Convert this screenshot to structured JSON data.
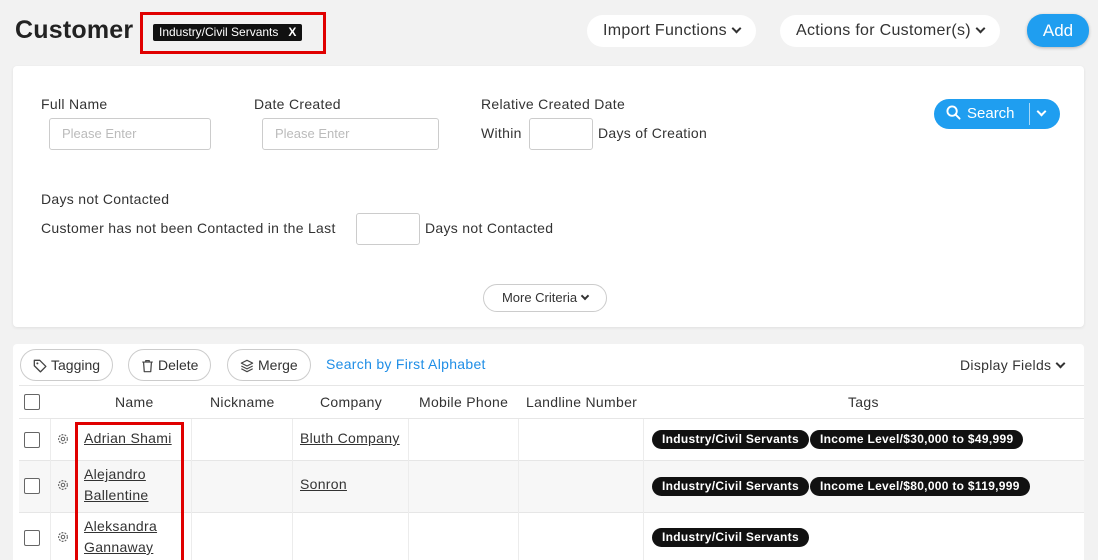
{
  "header": {
    "title": "Customer",
    "filter_chip": {
      "label": "Industry/Civil Servants",
      "remove": "X"
    },
    "import_label": "Import Functions",
    "actions_label": "Actions for Customer(s)",
    "add_label": "Add"
  },
  "search": {
    "full_name": {
      "label": "Full Name",
      "placeholder": "Please Enter"
    },
    "date_created": {
      "label": "Date Created",
      "placeholder": "Please Enter"
    },
    "relative": {
      "label": "Relative Created Date",
      "prefix": "Within",
      "suffix": "Days of Creation"
    },
    "not_contacted": {
      "label": "Days not Contacted",
      "prefix": "Customer has not been Contacted in the Last",
      "suffix": "Days not Contacted"
    },
    "search_label": "Search",
    "more_label": "More Criteria"
  },
  "toolbar": {
    "tagging": "Tagging",
    "delete": "Delete",
    "merge": "Merge",
    "alphabet": "Search by First Alphabet",
    "display_fields": "Display Fields"
  },
  "table": {
    "columns": [
      "Name",
      "Nickname",
      "Company",
      "Mobile Phone",
      "Landline Number",
      "Tags"
    ],
    "rows": [
      {
        "name_line1": "Adrian Shami",
        "name_line2": "",
        "company": "Bluth Company",
        "tags": [
          "Industry/Civil Servants",
          "Income Level/$30,000 to $49,999"
        ]
      },
      {
        "name_line1": "Alejandro",
        "name_line2": "Ballentine",
        "company": "Sonron",
        "tags": [
          "Industry/Civil Servants",
          "Income Level/$80,000 to $119,999"
        ]
      },
      {
        "name_line1": "Aleksandra",
        "name_line2": "Gannaway",
        "company": "",
        "tags": [
          "Industry/Civil Servants"
        ]
      }
    ]
  },
  "colors": {
    "accent": "#1f9ef0",
    "highlight": "#e00000",
    "tag_bg": "#111111"
  }
}
